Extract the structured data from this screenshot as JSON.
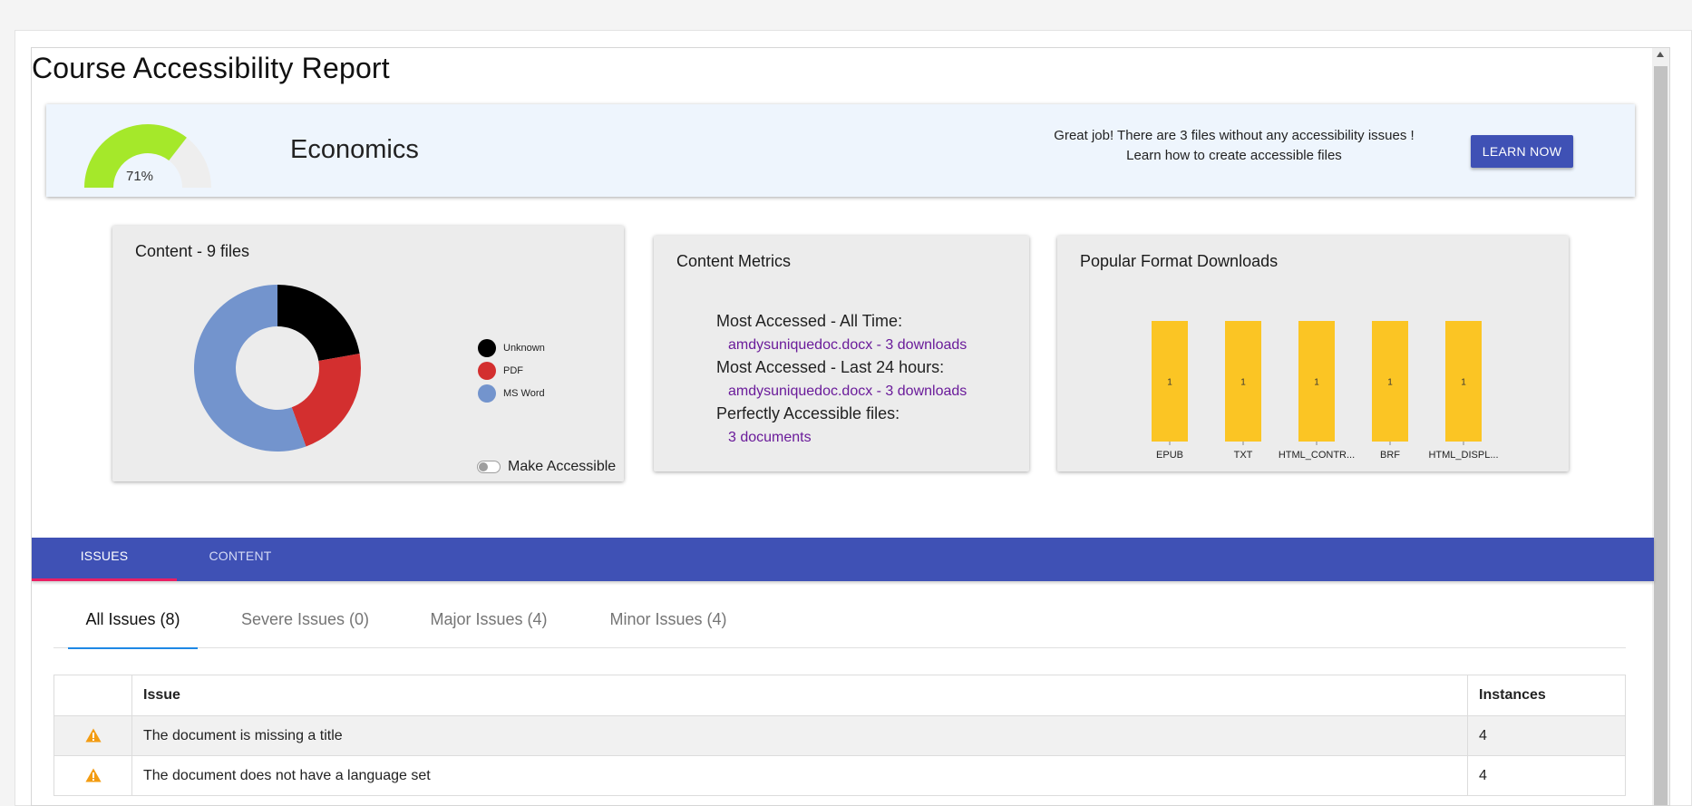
{
  "page": {
    "title": "Course Accessibility Report"
  },
  "banner": {
    "score_value": 71,
    "score_label": "71%",
    "course_name": "Economics",
    "message_line1": "Great job! There are 3 files without any accessibility issues !",
    "message_line2": "Learn how to create accessible files",
    "learn_button": "LEARN NOW",
    "gauge_color": "#a5e82a"
  },
  "content_card": {
    "title": "Content - 9 files",
    "toggle_label": "Make Accessible",
    "toggle_on": false
  },
  "chart_data": [
    {
      "type": "pie",
      "title": "Content - 9 files",
      "categories": [
        "Unknown",
        "PDF",
        "MS Word"
      ],
      "values": [
        2,
        2,
        5
      ],
      "colors": [
        "#000000",
        "#d32f2f",
        "#7394cd"
      ],
      "legend": "right"
    },
    {
      "type": "bar",
      "title": "Popular Format Downloads",
      "categories": [
        "EPUB",
        "TXT",
        "HTML_CONTR...",
        "BRF",
        "HTML_DISPL..."
      ],
      "values": [
        1,
        1,
        1,
        1,
        1
      ],
      "color": "#fbc524"
    }
  ],
  "metrics": {
    "title": "Content Metrics",
    "all_time_label": "Most Accessed - All Time:",
    "all_time_value": "amdysuniquedoc.docx - 3 downloads",
    "last24_label": "Most Accessed - Last 24 hours:",
    "last24_value": "amdysuniquedoc.docx - 3 downloads",
    "perfect_label": "Perfectly Accessible files:",
    "perfect_value": "3 documents"
  },
  "downloads": {
    "title": "Popular Format Downloads"
  },
  "tabs": [
    {
      "label": "ISSUES",
      "active": true
    },
    {
      "label": "CONTENT",
      "active": false
    }
  ],
  "subtabs": [
    {
      "label": "All Issues (8)",
      "active": true
    },
    {
      "label": "Severe Issues (0)",
      "active": false
    },
    {
      "label": "Major Issues (4)",
      "active": false
    },
    {
      "label": "Minor Issues (4)",
      "active": false
    }
  ],
  "issues_table": {
    "columns": [
      "",
      "Issue",
      "Instances"
    ],
    "rows": [
      {
        "icon": "warning-icon",
        "issue": "The document is missing a title",
        "instances": "4"
      },
      {
        "icon": "warning-icon",
        "issue": "The document does not have a language set",
        "instances": "4"
      }
    ]
  },
  "colors": {
    "primary": "#3f51b5",
    "accent": "#e91e63",
    "warning": "#f39c12",
    "link": "#6a1b9a"
  }
}
